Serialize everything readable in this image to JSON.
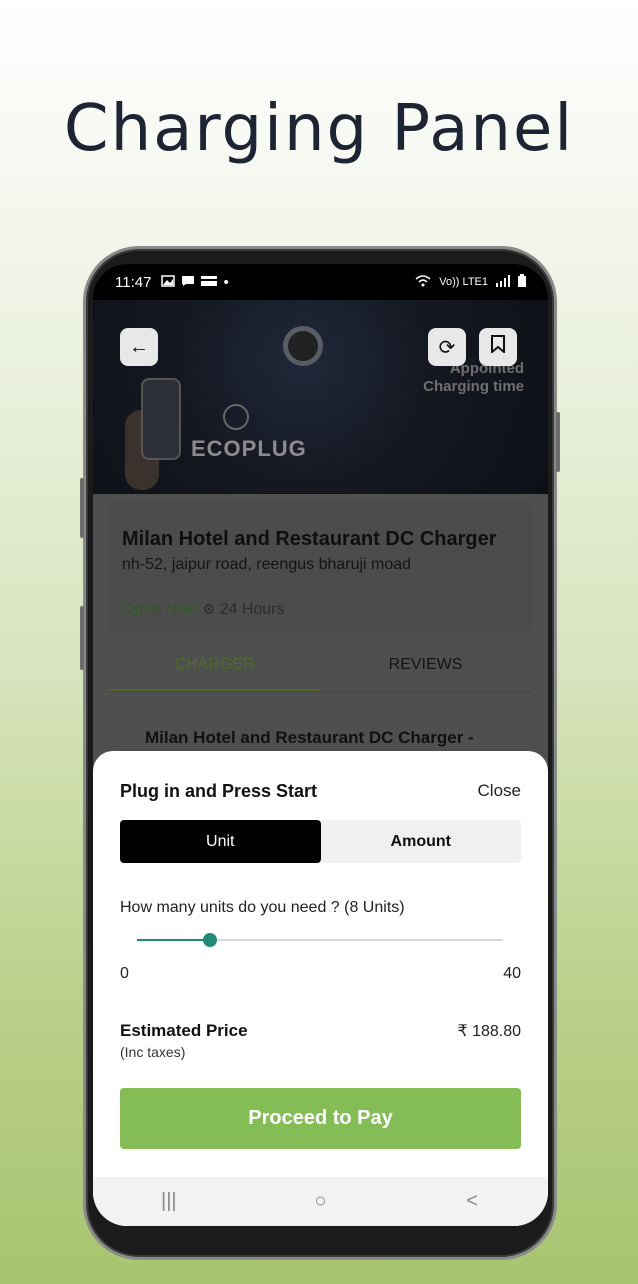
{
  "hero": {
    "title": "Charging Panel"
  },
  "statusbar": {
    "time": "11:47",
    "dot": "•",
    "network": "Vo)) LTE1"
  },
  "header": {
    "back_icon": "←",
    "refresh_icon": "⟳",
    "bookmark_icon": "❐",
    "brand": "ECOPLUG",
    "promo_line1": "Appointed",
    "promo_line2": "Charging time"
  },
  "station": {
    "name": "Milan Hotel and Restaurant DC Charger",
    "address": "nh-52, jaipur road, reengus bharuji moad",
    "status": "Open Now",
    "hours": "24 Hours"
  },
  "tabs": [
    {
      "label": "CHARGER",
      "active": true
    },
    {
      "label": "REVIEWS",
      "active": false
    }
  ],
  "charger_title": "Milan Hotel and Restaurant DC Charger -",
  "sheet": {
    "title": "Plug in and Press Start",
    "close_label": "Close",
    "segments": [
      {
        "label": "Unit",
        "active": true
      },
      {
        "label": "Amount",
        "active": false
      }
    ],
    "question": "How many units do you need ? (8 Units)",
    "slider": {
      "min": 0,
      "max": 40,
      "value": 8,
      "min_label": "0",
      "max_label": "40",
      "color": "#1f8a78"
    },
    "estimated_label": "Estimated Price",
    "estimated_sub": "(Inc taxes)",
    "estimated_price": "₹ 188.80",
    "pay_label": "Proceed to Pay",
    "pay_color": "#84bd55"
  },
  "navbar": {
    "recent": "|||",
    "home": "○",
    "back": "<"
  }
}
